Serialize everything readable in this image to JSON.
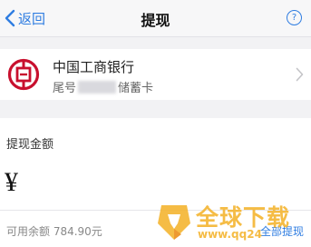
{
  "nav": {
    "back_label": "返回",
    "title": "提现",
    "help_label": "?"
  },
  "bank": {
    "name": "中国工商银行",
    "tail_prefix": "尾号",
    "card_type_suffix": "储蓄卡"
  },
  "amount": {
    "label": "提现金额",
    "currency_symbol": "¥",
    "balance_text": "可用余额 784.90元",
    "withdraw_all_label": "全部提现"
  },
  "watermark": {
    "title": "全球下载",
    "url": "www.qq24"
  },
  "colors": {
    "accent": "#2f7de1",
    "bank_red": "#c8102e",
    "watermark_orange": "#f5b531"
  },
  "icons": {
    "back": "chevron-left-icon",
    "help": "question-circle-icon",
    "bank": "icbc-logo-icon",
    "row_arrow": "chevron-right-icon"
  }
}
